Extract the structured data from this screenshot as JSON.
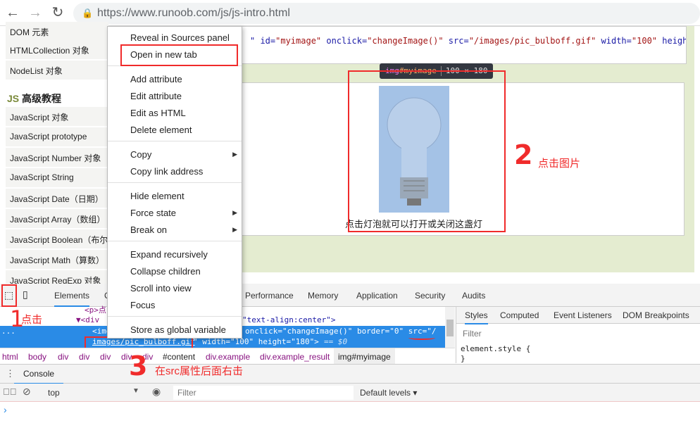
{
  "browser": {
    "url": "https://www.runoob.com/js/js-intro.html"
  },
  "sidebar": {
    "items": [
      "DOM 元素",
      "HTMLCollection 对象",
      "NodeList 对象"
    ],
    "section_prefix": "JS",
    "section_title": "高级教程",
    "items2": [
      "JavaScript 对象",
      "JavaScript prototype",
      "JavaScript Number 对象",
      "JavaScript String",
      "JavaScript Date（日期）",
      "JavaScript Array（数组）",
      "JavaScript Boolean（布尔",
      "JavaScript Math（算数）",
      "JavaScript RegExp 对象"
    ]
  },
  "page": {
    "code_a": "\" id=",
    "code_b": "\"myimage\"",
    "code_c": " onclick=",
    "code_d": "\"changeImage()\"",
    "code_e": " src=",
    "code_f": "\"/images/pic_bulboff.gif\"",
    "code_g": " width=",
    "code_h": "\"100\"",
    "code_i": " heigh",
    "caption": "点击灯泡就可以打开或关闭这盏灯",
    "tooltip_tag": "img",
    "tooltip_id": "#myimage",
    "tooltip_size": "100 × 180"
  },
  "context_menu": {
    "items": [
      "Reveal in Sources panel",
      "Open in new tab",
      "Add attribute",
      "Edit attribute",
      "Edit as HTML",
      "Delete element",
      "Copy",
      "Copy link address",
      "Hide element",
      "Force state",
      "Break on",
      "Expand recursively",
      "Collapse children",
      "Scroll into view",
      "Focus",
      "Store as global variable"
    ]
  },
  "devtools": {
    "tabs": [
      "Elements",
      "C",
      "Performance",
      "Memory",
      "Application",
      "Security",
      "Audits"
    ],
    "elements": {
      "line1": "<p>点",
      "line2": "▼<div",
      "line2b": "\"text-align:center\">",
      "sel1a": "<img",
      "sel1b": "onclick=\"changeImage()\" border=\"0\" src=\"/",
      "sel2a": "images/pic_bulboff.gif",
      "sel2b": "\" width=\"100\" height=\"180\">",
      "sel2c": "== $0",
      "ellipsis": "..."
    },
    "breadcrumbs": [
      "html",
      "body",
      "div",
      "div",
      "div",
      "div",
      "div",
      "#content",
      "div.example",
      "div.example_result",
      "img#myimage"
    ],
    "styles_tabs": [
      "Styles",
      "Computed",
      "Event Listeners",
      "DOM Breakpoints"
    ],
    "styles_filter_placeholder": "Filter",
    "element_style": "element.style {",
    "close_brace": "}",
    "console_tab": "Console",
    "context_select": "top",
    "console_filter_placeholder": "Filter",
    "levels": "Default levels ▾",
    "prompt": "›"
  },
  "annotations": {
    "n1": "1",
    "t1": "点击",
    "n2": "2",
    "t2": "点击图片",
    "n3": "3",
    "t3": "在src属性后面右击"
  },
  "colors": {
    "annotation": "#f02b2b",
    "selection": "#2a8be6"
  }
}
